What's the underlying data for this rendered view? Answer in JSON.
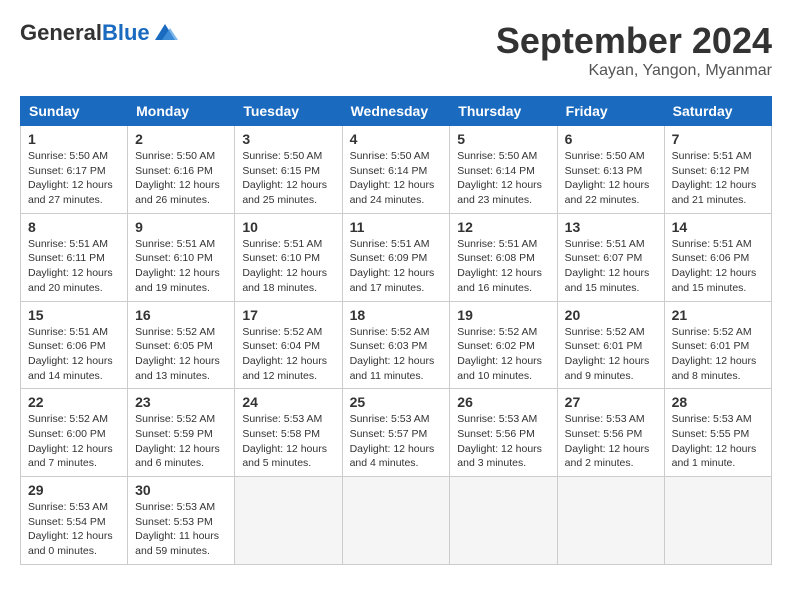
{
  "header": {
    "logo_general": "General",
    "logo_blue": "Blue",
    "month_title": "September 2024",
    "location": "Kayan, Yangon, Myanmar"
  },
  "columns": [
    "Sunday",
    "Monday",
    "Tuesday",
    "Wednesday",
    "Thursday",
    "Friday",
    "Saturday"
  ],
  "weeks": [
    [
      {
        "day": "1",
        "info": "Sunrise: 5:50 AM\nSunset: 6:17 PM\nDaylight: 12 hours\nand 27 minutes."
      },
      {
        "day": "2",
        "info": "Sunrise: 5:50 AM\nSunset: 6:16 PM\nDaylight: 12 hours\nand 26 minutes."
      },
      {
        "day": "3",
        "info": "Sunrise: 5:50 AM\nSunset: 6:15 PM\nDaylight: 12 hours\nand 25 minutes."
      },
      {
        "day": "4",
        "info": "Sunrise: 5:50 AM\nSunset: 6:14 PM\nDaylight: 12 hours\nand 24 minutes."
      },
      {
        "day": "5",
        "info": "Sunrise: 5:50 AM\nSunset: 6:14 PM\nDaylight: 12 hours\nand 23 minutes."
      },
      {
        "day": "6",
        "info": "Sunrise: 5:50 AM\nSunset: 6:13 PM\nDaylight: 12 hours\nand 22 minutes."
      },
      {
        "day": "7",
        "info": "Sunrise: 5:51 AM\nSunset: 6:12 PM\nDaylight: 12 hours\nand 21 minutes."
      }
    ],
    [
      {
        "day": "8",
        "info": "Sunrise: 5:51 AM\nSunset: 6:11 PM\nDaylight: 12 hours\nand 20 minutes."
      },
      {
        "day": "9",
        "info": "Sunrise: 5:51 AM\nSunset: 6:10 PM\nDaylight: 12 hours\nand 19 minutes."
      },
      {
        "day": "10",
        "info": "Sunrise: 5:51 AM\nSunset: 6:10 PM\nDaylight: 12 hours\nand 18 minutes."
      },
      {
        "day": "11",
        "info": "Sunrise: 5:51 AM\nSunset: 6:09 PM\nDaylight: 12 hours\nand 17 minutes."
      },
      {
        "day": "12",
        "info": "Sunrise: 5:51 AM\nSunset: 6:08 PM\nDaylight: 12 hours\nand 16 minutes."
      },
      {
        "day": "13",
        "info": "Sunrise: 5:51 AM\nSunset: 6:07 PM\nDaylight: 12 hours\nand 15 minutes."
      },
      {
        "day": "14",
        "info": "Sunrise: 5:51 AM\nSunset: 6:06 PM\nDaylight: 12 hours\nand 15 minutes."
      }
    ],
    [
      {
        "day": "15",
        "info": "Sunrise: 5:51 AM\nSunset: 6:06 PM\nDaylight: 12 hours\nand 14 minutes."
      },
      {
        "day": "16",
        "info": "Sunrise: 5:52 AM\nSunset: 6:05 PM\nDaylight: 12 hours\nand 13 minutes."
      },
      {
        "day": "17",
        "info": "Sunrise: 5:52 AM\nSunset: 6:04 PM\nDaylight: 12 hours\nand 12 minutes."
      },
      {
        "day": "18",
        "info": "Sunrise: 5:52 AM\nSunset: 6:03 PM\nDaylight: 12 hours\nand 11 minutes."
      },
      {
        "day": "19",
        "info": "Sunrise: 5:52 AM\nSunset: 6:02 PM\nDaylight: 12 hours\nand 10 minutes."
      },
      {
        "day": "20",
        "info": "Sunrise: 5:52 AM\nSunset: 6:01 PM\nDaylight: 12 hours\nand 9 minutes."
      },
      {
        "day": "21",
        "info": "Sunrise: 5:52 AM\nSunset: 6:01 PM\nDaylight: 12 hours\nand 8 minutes."
      }
    ],
    [
      {
        "day": "22",
        "info": "Sunrise: 5:52 AM\nSunset: 6:00 PM\nDaylight: 12 hours\nand 7 minutes."
      },
      {
        "day": "23",
        "info": "Sunrise: 5:52 AM\nSunset: 5:59 PM\nDaylight: 12 hours\nand 6 minutes."
      },
      {
        "day": "24",
        "info": "Sunrise: 5:53 AM\nSunset: 5:58 PM\nDaylight: 12 hours\nand 5 minutes."
      },
      {
        "day": "25",
        "info": "Sunrise: 5:53 AM\nSunset: 5:57 PM\nDaylight: 12 hours\nand 4 minutes."
      },
      {
        "day": "26",
        "info": "Sunrise: 5:53 AM\nSunset: 5:56 PM\nDaylight: 12 hours\nand 3 minutes."
      },
      {
        "day": "27",
        "info": "Sunrise: 5:53 AM\nSunset: 5:56 PM\nDaylight: 12 hours\nand 2 minutes."
      },
      {
        "day": "28",
        "info": "Sunrise: 5:53 AM\nSunset: 5:55 PM\nDaylight: 12 hours\nand 1 minute."
      }
    ],
    [
      {
        "day": "29",
        "info": "Sunrise: 5:53 AM\nSunset: 5:54 PM\nDaylight: 12 hours\nand 0 minutes."
      },
      {
        "day": "30",
        "info": "Sunrise: 5:53 AM\nSunset: 5:53 PM\nDaylight: 11 hours\nand 59 minutes."
      },
      null,
      null,
      null,
      null,
      null
    ]
  ]
}
